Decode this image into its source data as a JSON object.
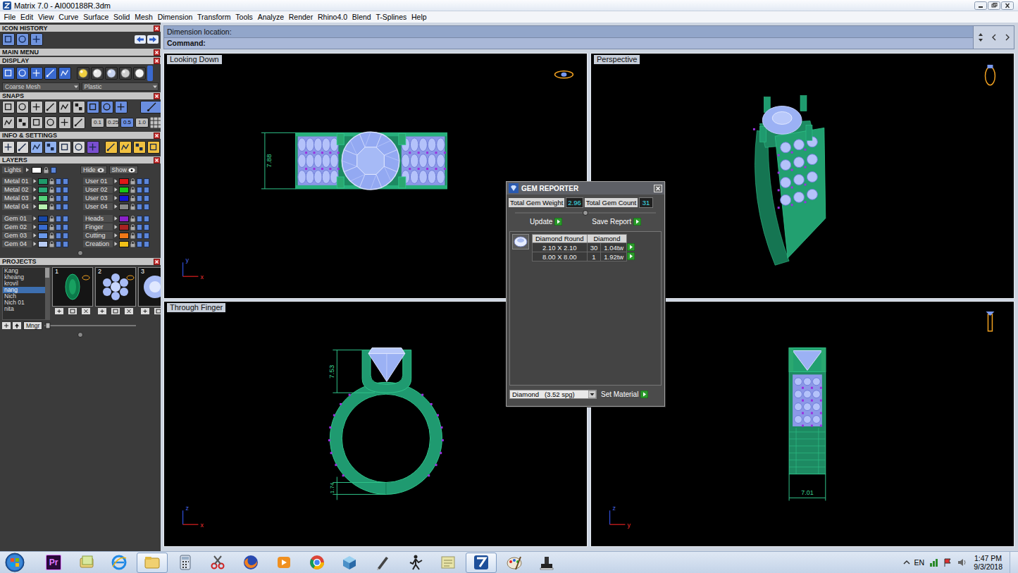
{
  "window": {
    "title": "Matrix 7.0 - AI000188R.3dm"
  },
  "menu": [
    "File",
    "Edit",
    "View",
    "Curve",
    "Surface",
    "Solid",
    "Mesh",
    "Dimension",
    "Transform",
    "Tools",
    "Analyze",
    "Render",
    "Rhino4.0",
    "Blend",
    "T-Splines",
    "Help"
  ],
  "left_panel": {
    "icon_history": {
      "title": "ICON HISTORY"
    },
    "main_menu": {
      "title": "MAIN MENU"
    },
    "display": {
      "title": "DISPLAY",
      "mesh": "Coarse Mesh",
      "material": "Plastic"
    },
    "snaps": {
      "title": "SNAPS",
      "toggles": [
        {
          "on": false
        },
        {
          "on": false
        },
        {
          "on": false
        },
        {
          "on": false
        },
        {
          "on": false
        },
        {
          "on": false
        },
        {
          "on": true
        },
        {
          "on": true
        },
        {
          "on": true
        },
        {
          "on": true
        },
        {
          "on": false
        },
        {
          "on": false
        },
        {
          "on": false
        },
        {
          "on": false
        },
        {
          "on": false
        },
        {
          "on": false
        }
      ],
      "steps": [
        {
          "label": "0.1",
          "selected": false
        },
        {
          "label": "0.25",
          "selected": false
        },
        {
          "label": "0.5",
          "selected": true
        },
        {
          "label": "1.0",
          "selected": false
        }
      ]
    },
    "info": {
      "title": "INFO & SETTINGS"
    },
    "layers": {
      "title": "LAYERS",
      "lights": "Lights",
      "hide": "Hide",
      "show": "Show",
      "items": [
        {
          "name": "Metal 01",
          "color": "#1f9a6a"
        },
        {
          "name": "User 01",
          "color": "#e01818"
        },
        {
          "name": "Metal 02",
          "color": "#2aa878"
        },
        {
          "name": "User 02",
          "color": "#18c818"
        },
        {
          "name": "Metal 03",
          "color": "#55d27a"
        },
        {
          "name": "User 03",
          "color": "#1818d8"
        },
        {
          "name": "Metal 04",
          "color": "#b8f0b0"
        },
        {
          "name": "User 04",
          "color": "#8a8a8a"
        },
        {
          "name": "Gem 01",
          "color": "#1848a8"
        },
        {
          "name": "Heads",
          "color": "#8a22c8"
        },
        {
          "name": "Gem 02",
          "color": "#3a6cd0"
        },
        {
          "name": "Finger",
          "color": "#a82222"
        },
        {
          "name": "Gem 03",
          "color": "#6a98e8"
        },
        {
          "name": "Cutting",
          "color": "#f07818"
        },
        {
          "name": "Gem 04",
          "color": "#b8ccf4"
        },
        {
          "name": "Creation",
          "color": "#f0c018"
        }
      ]
    },
    "projects": {
      "title": "PROJECTS",
      "items": [
        {
          "name": "Kang",
          "selected": false
        },
        {
          "name": "kheang",
          "selected": false
        },
        {
          "name": "krovil",
          "selected": false
        },
        {
          "name": "nang",
          "selected": true
        },
        {
          "name": "Nich",
          "selected": false
        },
        {
          "name": "Nich 01",
          "selected": false
        },
        {
          "name": "nita",
          "selected": false
        }
      ],
      "thumbnails": [
        {
          "number": "1",
          "kind": "emerald"
        },
        {
          "number": "2",
          "kind": "cluster"
        },
        {
          "number": "3",
          "kind": "halo"
        }
      ],
      "manager": "Mngr"
    }
  },
  "command": {
    "prompt": "Dimension location:",
    "label": "Command:"
  },
  "viewports": [
    {
      "label": "Looking Down",
      "kind": "top",
      "dimensions": [
        "7.88"
      ],
      "axes": [
        "y",
        "x"
      ]
    },
    {
      "label": "Perspective",
      "kind": "perspective",
      "dimensions": [],
      "axes": []
    },
    {
      "label": "Through Finger",
      "kind": "front",
      "dimensions": [
        "7.53",
        "1.74"
      ],
      "axes": [
        "z",
        "x"
      ]
    },
    {
      "kind": "side",
      "dimensions": [
        "7.01"
      ],
      "axes": [
        "z",
        "y"
      ]
    }
  ],
  "gem_reporter": {
    "title": "GEM REPORTER",
    "weight_label": "Total Gem Weight",
    "weight": "2.96",
    "count_label": "Total Gem Count",
    "count": "31",
    "update": "Update",
    "save": "Save Report",
    "columns": [
      "Diamond Round",
      "Diamond"
    ],
    "rows": [
      {
        "size": "2.10 X 2.10",
        "count": "30",
        "weight": "1.04tw"
      },
      {
        "size": "8.00 X 8.00",
        "count": "1",
        "weight": "1.92tw"
      }
    ],
    "material": "Diamond   (3.52 spg)",
    "set_material": "Set Material"
  },
  "taskbar": {
    "apps": [
      {
        "kind": "premiere",
        "label": "Pr",
        "active": false
      },
      {
        "kind": "folders",
        "active": false
      },
      {
        "kind": "ie",
        "active": false
      },
      {
        "kind": "explorer",
        "active": true
      },
      {
        "kind": "calculator",
        "active": false
      },
      {
        "kind": "snipping",
        "active": false
      },
      {
        "kind": "firefox",
        "active": false
      },
      {
        "kind": "media",
        "active": false
      },
      {
        "kind": "chrome",
        "active": false
      },
      {
        "kind": "cube",
        "active": false
      },
      {
        "kind": "pen",
        "active": false
      },
      {
        "kind": "figure",
        "active": false
      },
      {
        "kind": "notes",
        "active": false
      },
      {
        "kind": "matrix",
        "active": true
      },
      {
        "kind": "paint",
        "active": false
      },
      {
        "kind": "stamp",
        "active": false
      }
    ],
    "language": "EN",
    "time": "1:47 PM",
    "date": "9/3/2018"
  }
}
